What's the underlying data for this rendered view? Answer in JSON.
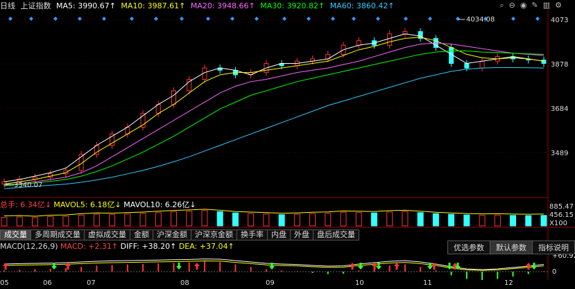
{
  "top": {
    "period": "日线",
    "index_name": "上证指数",
    "ma5": "MA5: 3990.67↑",
    "ma10": "MA10: 3987.61↑",
    "ma20": "MA20: 3948.66↑",
    "ma30": "MA30: 3920.82↑",
    "ma60": "MA60: 3860.42↑",
    "colors": {
      "ma5": "#ffffff",
      "ma10": "#ffff00",
      "ma20": "#ff66ff",
      "ma30": "#00ff00",
      "ma60": "#33ccff"
    }
  },
  "price_axis": [
    "4073",
    "3878",
    "3684",
    "3489"
  ],
  "annotations": {
    "high": "4034.08",
    "low": "3340.07"
  },
  "volume": {
    "total": "总手: 6.34亿↓",
    "mavol5": "MAVOL5: 6.18亿↓",
    "mavol10": "MAVOL10: 6.26亿↓",
    "axis": [
      "885.47",
      "456.15",
      "X100"
    ]
  },
  "tabs": [
    "成交量",
    "多周期成交量",
    "虚拟成交量",
    "金额",
    "沪深金额",
    "沪深京金额",
    "换手率",
    "内盘",
    "外盘",
    "盘后成交量"
  ],
  "macd": {
    "title": "MACD(12,26,9)",
    "macd": "MACD: +2.31↑",
    "diff": "DIFF: +38.20↑",
    "dea": "DEA: +37.04↑",
    "axis": [
      "+60.92",
      "0"
    ],
    "buttons": [
      "优选参数",
      "默认参数",
      "指标说明"
    ]
  },
  "months": [
    "05",
    "06",
    "07",
    "08",
    "09",
    "10",
    "11",
    "12"
  ],
  "chart_data": {
    "type": "candlestick",
    "title": "上证指数 日线",
    "ylim": [
      3300,
      4110
    ],
    "series": [
      {
        "name": "MA5",
        "values": [
          3360,
          3370,
          3385,
          3400,
          3420,
          3470,
          3520,
          3560,
          3600,
          3650,
          3700,
          3740,
          3800,
          3840,
          3860,
          3850,
          3830,
          3860,
          3880,
          3880,
          3890,
          3900,
          3940,
          3960,
          3970,
          3990,
          4010,
          4000,
          3960,
          3920,
          3880,
          3890,
          3900,
          3910,
          3900,
          3890
        ]
      },
      {
        "name": "MA10",
        "values": [
          3350,
          3360,
          3370,
          3385,
          3400,
          3440,
          3490,
          3530,
          3570,
          3610,
          3660,
          3700,
          3750,
          3800,
          3830,
          3840,
          3840,
          3850,
          3860,
          3870,
          3880,
          3890,
          3915,
          3940,
          3955,
          3975,
          3990,
          3995,
          3980,
          3950,
          3920,
          3905,
          3900,
          3905,
          3900,
          3890
        ]
      },
      {
        "name": "MA20",
        "values": [
          3345,
          3352,
          3360,
          3370,
          3380,
          3400,
          3430,
          3470,
          3510,
          3550,
          3590,
          3630,
          3670,
          3710,
          3750,
          3780,
          3800,
          3810,
          3825,
          3840,
          3850,
          3860,
          3875,
          3890,
          3910,
          3930,
          3950,
          3965,
          3970,
          3965,
          3955,
          3945,
          3935,
          3925,
          3920,
          3915
        ]
      },
      {
        "name": "MA30",
        "values": [
          3342,
          3348,
          3355,
          3362,
          3370,
          3385,
          3405,
          3430,
          3460,
          3490,
          3525,
          3560,
          3600,
          3640,
          3680,
          3710,
          3740,
          3760,
          3780,
          3800,
          3815,
          3830,
          3845,
          3860,
          3875,
          3890,
          3905,
          3920,
          3930,
          3935,
          3935,
          3930,
          3928,
          3925,
          3922,
          3920
        ]
      },
      {
        "name": "MA60",
        "values": [
          3330,
          3335,
          3340,
          3345,
          3350,
          3358,
          3368,
          3380,
          3395,
          3410,
          3428,
          3448,
          3470,
          3495,
          3520,
          3545,
          3570,
          3595,
          3620,
          3645,
          3670,
          3695,
          3715,
          3735,
          3755,
          3775,
          3795,
          3815,
          3830,
          3845,
          3855,
          3860,
          3862,
          3862,
          3861,
          3860
        ]
      }
    ],
    "candles_close": [
      3360,
      3372,
      3380,
      3395,
      3410,
      3480,
      3520,
      3570,
      3600,
      3660,
      3700,
      3760,
      3810,
      3860,
      3850,
      3830,
      3840,
      3880,
      3870,
      3890,
      3900,
      3920,
      3960,
      3980,
      3960,
      4010,
      4020,
      3990,
      3950,
      3880,
      3860,
      3890,
      3910,
      3900,
      3895,
      3880
    ],
    "volume_values": [
      5.2,
      5.4,
      5.0,
      5.6,
      5.8,
      6.5,
      7.0,
      6.8,
      7.2,
      7.5,
      8.0,
      8.5,
      8.8,
      9.2,
      8.6,
      7.8,
      7.5,
      7.2,
      6.8,
      7.0,
      7.4,
      7.6,
      8.2,
      8.0,
      7.8,
      8.4,
      8.6,
      8.0,
      7.4,
      7.0,
      6.6,
      6.4,
      6.5,
      6.3,
      6.2,
      6.34
    ],
    "macd_hist": [
      5,
      8,
      10,
      12,
      15,
      20,
      25,
      28,
      30,
      32,
      34,
      36,
      38,
      42,
      40,
      30,
      20,
      10,
      5,
      2,
      -5,
      -10,
      -8,
      5,
      15,
      25,
      30,
      20,
      5,
      -15,
      -30,
      -35,
      -30,
      -20,
      -10,
      2.31
    ]
  }
}
